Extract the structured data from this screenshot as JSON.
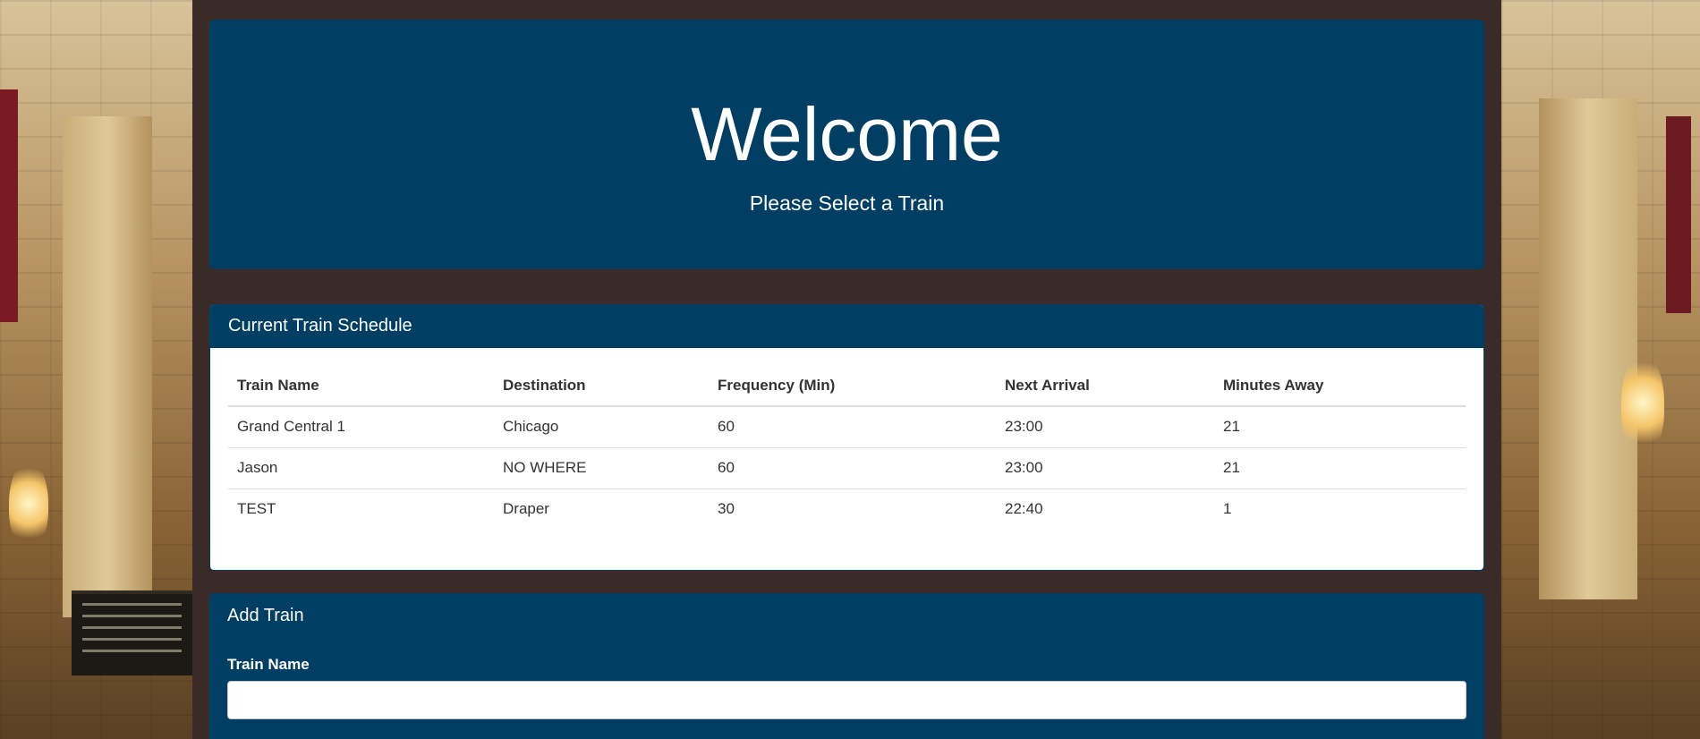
{
  "jumbotron": {
    "title": "Welcome",
    "subtitle": "Please Select a Train"
  },
  "schedule": {
    "heading": "Current Train Schedule",
    "columns": [
      "Train Name",
      "Destination",
      "Frequency (Min)",
      "Next Arrival",
      "Minutes Away"
    ],
    "rows": [
      [
        "Grand Central 1",
        "Chicago",
        "60",
        "23:00",
        "21"
      ],
      [
        "Jason",
        "NO WHERE",
        "60",
        "23:00",
        "21"
      ],
      [
        "TEST",
        "Draper",
        "30",
        "22:40",
        "1"
      ]
    ]
  },
  "add_train": {
    "heading": "Add Train",
    "train_name_label": "Train Name",
    "train_name_value": ""
  },
  "colors": {
    "panel_blue": "#003f63",
    "page_bg": "#3b2b28"
  }
}
